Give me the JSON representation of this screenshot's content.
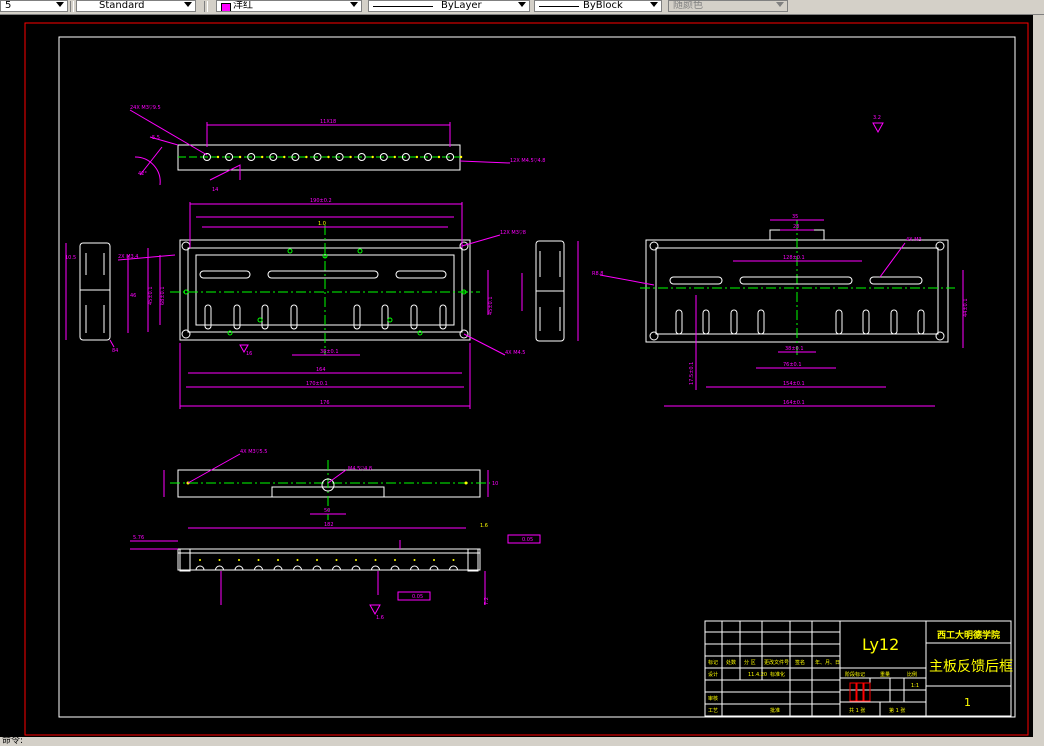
{
  "toolbar": {
    "dimstyle_partial": "5",
    "textstyle": "Standard",
    "color": "洋红",
    "linetype": "ByLayer",
    "lineweight": "ByBlock",
    "plotstyle": "随颜色"
  },
  "title_block": {
    "material": "Ly12",
    "school": "西工大明德学院",
    "part_name": "主板反馈后框",
    "drawing_no": "1",
    "scale": "1:1",
    "sheet_total": "共 1 张",
    "sheet_index": "第 1 张",
    "col_biaoji": "标记",
    "col_chushu": "处数",
    "col_fenqu": "分 区",
    "col_wenjian": "更改文件号",
    "col_qianming": "签名",
    "col_riqi": "年、月、日",
    "row_sheji": "设计",
    "row_sheji_date": "11.4.20",
    "row_biaozhunhua": "标准化",
    "row_shenhe": "审核",
    "row_gongyi": "工艺",
    "row_pizhun": "批准",
    "stage_mark": "阶段标记",
    "weight": "重量",
    "scale_label": "比例"
  },
  "annotations": {
    "top_strip_holes": "24X M3▽9.5",
    "top_strip_pitch": "11X18",
    "top_strip_callout": "12X M4.5▽4.8",
    "angle_note": "42°",
    "dim_14": "14",
    "dim_5": "5.5",
    "main_190": "190±0.2",
    "main_170": "170±0.1",
    "main_176": "176",
    "main_164": "164",
    "main_38": "38±0.1",
    "main_tol": "1.0",
    "main_callout_r": "12X M3▽8",
    "main_callout_l": "2X M3.4",
    "main_h1": "45±0.1",
    "main_h2": "68±0.1",
    "main_r": "4X M4.5",
    "side_105": "10.5",
    "side_46": "46",
    "side_84": "84",
    "right_r88": "R8.8",
    "right_35": "35",
    "right_28": "28",
    "right_128": "128±0.1",
    "right_154": "154±0.1",
    "right_164": "164±0.1",
    "right_76": "76±0.1",
    "right_38": "38±0.1",
    "right_17": "17.5±0.1",
    "right_4x": "4X M3",
    "right_h": "44±0.1",
    "rough_32": "3.2",
    "bottom_182": "182",
    "bottom_50": "50",
    "bottom_m3": "4X M3▽5.5",
    "bottom_m4": "M4.5▽4.8",
    "bottom_16": "16",
    "bottom_10": "10",
    "bottom_576": "5.76",
    "bottom_flat1": "0.05",
    "bottom_flat2": "0.05",
    "bottom_1": "1.6",
    "bottom_r": "1.6",
    "bottom_h": "7.2"
  },
  "status": {
    "prompt": "命令: "
  },
  "colors": {
    "frame": "#ff0000",
    "dims": "#ff00ff",
    "geometry": "#ffffff",
    "center": "#00ff00",
    "holes": "#ffff00",
    "title_text": "#ffff00"
  }
}
